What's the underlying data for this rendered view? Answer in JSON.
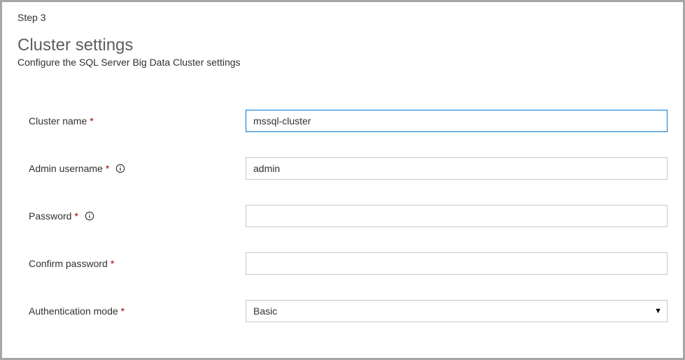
{
  "step": "Step 3",
  "title": "Cluster settings",
  "subtitle": "Configure the SQL Server Big Data Cluster settings",
  "fields": {
    "cluster_name": {
      "label": "Cluster name",
      "value": "mssql-cluster"
    },
    "admin_username": {
      "label": "Admin username",
      "value": "admin"
    },
    "password": {
      "label": "Password",
      "value": ""
    },
    "confirm_password": {
      "label": "Confirm password",
      "value": ""
    },
    "auth_mode": {
      "label": "Authentication mode",
      "selected": "Basic"
    }
  },
  "required_marker": "*"
}
